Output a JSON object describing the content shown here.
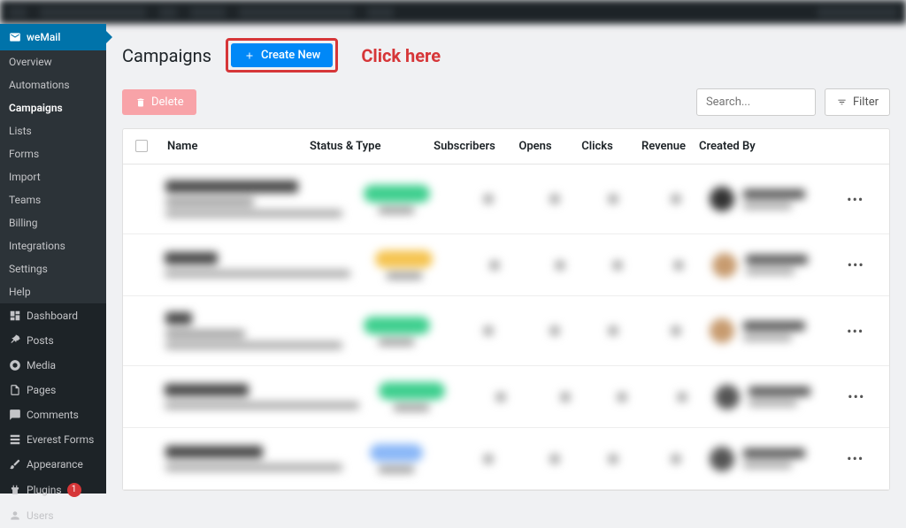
{
  "topbar": {},
  "sidebar": {
    "brand": "weMail",
    "sub_items": [
      {
        "label": "Overview",
        "active": false
      },
      {
        "label": "Automations",
        "active": false
      },
      {
        "label": "Campaigns",
        "active": true
      },
      {
        "label": "Lists",
        "active": false
      },
      {
        "label": "Forms",
        "active": false
      },
      {
        "label": "Import",
        "active": false
      },
      {
        "label": "Teams",
        "active": false
      },
      {
        "label": "Billing",
        "active": false
      },
      {
        "label": "Integrations",
        "active": false
      },
      {
        "label": "Settings",
        "active": false
      },
      {
        "label": "Help",
        "active": false
      }
    ],
    "main_items": [
      {
        "icon": "dashboard",
        "label": "Dashboard"
      },
      {
        "icon": "pin",
        "label": "Posts"
      },
      {
        "icon": "media",
        "label": "Media"
      },
      {
        "icon": "pages",
        "label": "Pages"
      },
      {
        "icon": "comment",
        "label": "Comments"
      },
      {
        "icon": "forms",
        "label": "Everest Forms"
      },
      {
        "icon": "appearance",
        "label": "Appearance"
      },
      {
        "icon": "plugin",
        "label": "Plugins",
        "badge": "1"
      },
      {
        "icon": "users",
        "label": "Users"
      }
    ]
  },
  "header": {
    "title": "Campaigns",
    "create_label": "Create New",
    "hint": "Click here"
  },
  "toolbar": {
    "delete_label": "Delete",
    "search_placeholder": "Search...",
    "filter_label": "Filter"
  },
  "table": {
    "headers": {
      "name": "Name",
      "status": "Status & Type",
      "subscribers": "Subscribers",
      "opens": "Opens",
      "clicks": "Clicks",
      "revenue": "Revenue",
      "created_by": "Created By"
    },
    "rows": [
      {
        "name_w": 150,
        "sub_w": 100,
        "txt_w": 200,
        "pill_color": "#3ecf8e",
        "pill_w": 75,
        "avatar": "#333"
      },
      {
        "name_w": 60,
        "sub_w": 0,
        "txt_w": 210,
        "pill_color": "#f5c451",
        "pill_w": 65,
        "avatar": "#c79b6f"
      },
      {
        "name_w": 30,
        "sub_w": 90,
        "txt_w": 200,
        "pill_color": "#3ecf8e",
        "pill_w": 75,
        "avatar": "#c79b6f"
      },
      {
        "name_w": 95,
        "sub_w": 0,
        "txt_w": 220,
        "pill_color": "#3ecf8e",
        "pill_w": 75,
        "avatar": "#555"
      },
      {
        "name_w": 110,
        "sub_w": 0,
        "txt_w": 200,
        "pill_color": "#8ab7f7",
        "pill_w": 60,
        "avatar": "#555"
      }
    ]
  }
}
